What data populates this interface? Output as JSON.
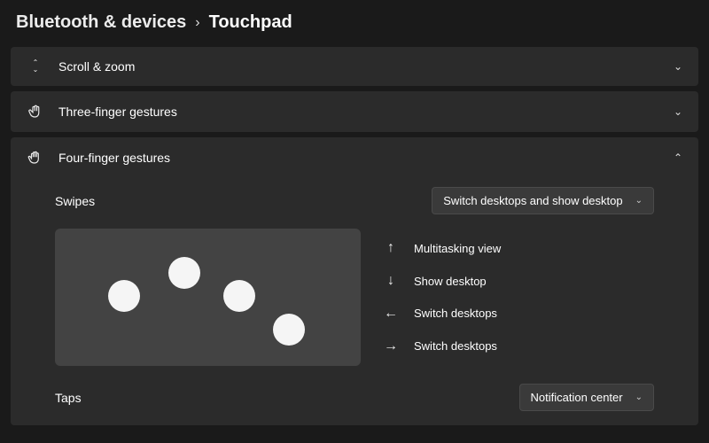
{
  "breadcrumb": {
    "parent": "Bluetooth & devices",
    "current": "Touchpad"
  },
  "panels": {
    "scroll_zoom": {
      "label": "Scroll & zoom"
    },
    "three_finger": {
      "label": "Three-finger gestures"
    },
    "four_finger": {
      "label": "Four-finger gestures"
    }
  },
  "four_finger": {
    "swipes_label": "Swipes",
    "swipes_dropdown": "Switch desktops and show desktop",
    "taps_label": "Taps",
    "taps_dropdown": "Notification center",
    "gestures": {
      "up": {
        "label": "Multitasking view"
      },
      "down": {
        "label": "Show desktop"
      },
      "left": {
        "label": "Switch desktops"
      },
      "right": {
        "label": "Switch desktops"
      }
    }
  }
}
